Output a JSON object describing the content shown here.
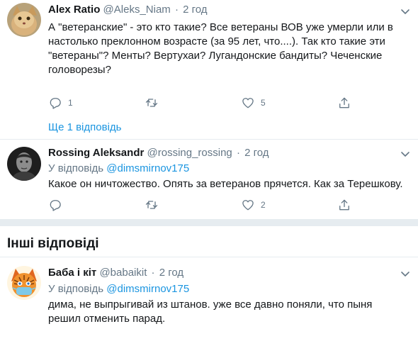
{
  "tweets": [
    {
      "name": "Alex Ratio",
      "handle": "@Aleks_Niam",
      "dot": "·",
      "time": "2 год",
      "text_lines": [
        "А \"ветеранские\" - это кто такие? Все ветераны ВОВ уже умерли или в",
        "настолько преклонном возрасте (за 95 лет, что....). Так кто такие эти",
        "\"ветераны\"? Менты? Вертухаи? Лугандонские бандиты? Чеченские",
        "головорезы?"
      ],
      "reply_count": "1",
      "retweet_count": "",
      "like_count": "5",
      "show_replies": "Ще 1 відповідь"
    },
    {
      "name": "Rossing Aleksandr",
      "handle": "@rossing_rossing",
      "dot": "·",
      "time": "2 год",
      "reply_to_prefix": "У відповідь",
      "reply_to_mention": "@dimsmirnov175",
      "text_lines": [
        "Какое он ничтожество. Опять за ветеранов прячется. Как за Терешкову."
      ],
      "reply_count": "",
      "retweet_count": "",
      "like_count": "2"
    },
    {
      "name": "Баба і кіт",
      "handle": "@babaikit",
      "dot": "·",
      "time": "2 год",
      "reply_to_prefix": "У відповідь",
      "reply_to_mention": "@dimsmirnov175",
      "text_lines": [
        "дима, не выпрыгивай из штанов. уже все давно поняли, что пыня",
        "решил отменить парад."
      ]
    }
  ],
  "section_title": "Інші відповіді",
  "icons": {
    "reply": "reply-icon",
    "retweet": "retweet-icon",
    "like": "like-icon",
    "share": "share-icon",
    "more": "chevron-down-icon"
  },
  "colors": {
    "accent": "#1b95e0",
    "text": "#14171a",
    "secondary": "#657786",
    "divider": "#e6ecf0"
  }
}
